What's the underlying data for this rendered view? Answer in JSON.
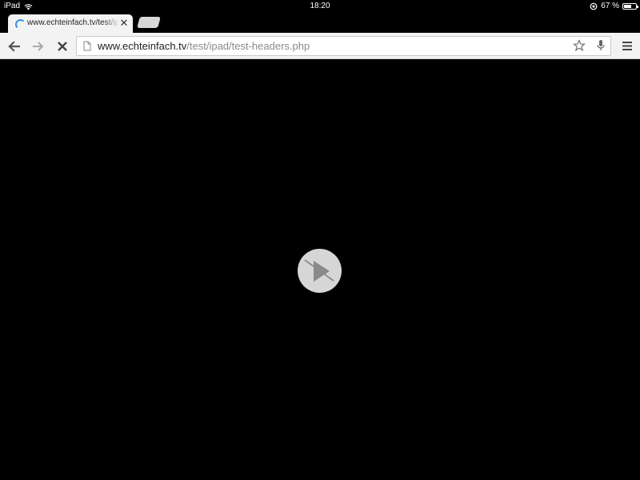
{
  "status_bar": {
    "device": "iPad",
    "time": "18:20",
    "battery_percent_text": "67 %",
    "battery_level": 0.67
  },
  "tabs": [
    {
      "title": "www.echteinfach.tv/test/ipad/test-headers.php",
      "active": true,
      "loading": true
    }
  ],
  "toolbar": {
    "url_host": "www.echteinfach.tv",
    "url_path": "/test/ipad/test-headers.php"
  },
  "video": {
    "state": "unavailable",
    "icon": "play-slashed-icon"
  },
  "colors": {
    "spinner": "#3b8ee6",
    "chrome_background": "#f3f3f3",
    "page_background": "#000000"
  }
}
